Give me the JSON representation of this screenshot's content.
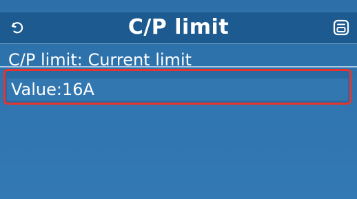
{
  "header": {
    "title": "C/P limit",
    "back_icon": "back-arrow-icon",
    "save_icon": "save-icon"
  },
  "rows": [
    {
      "text": "C/P limit: Current limit"
    },
    {
      "text": "Value:16A",
      "highlighted": true
    }
  ],
  "colors": {
    "background": "#2f73ad",
    "header": "#1c5a90",
    "highlight_border": "#e8332c",
    "text": "#ffffff"
  }
}
